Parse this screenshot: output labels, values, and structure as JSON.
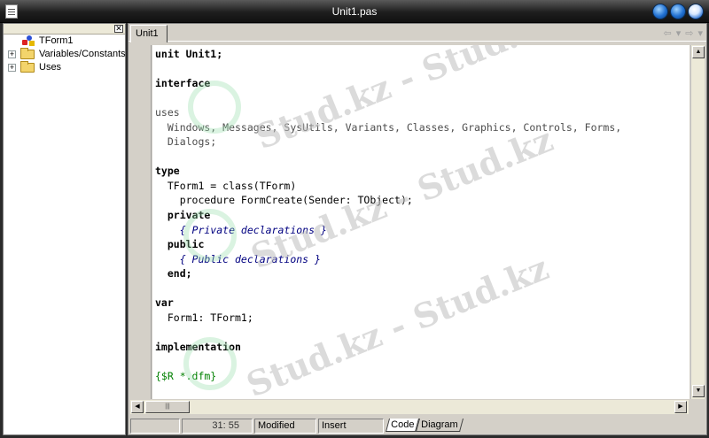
{
  "window": {
    "title": "Unit1.pas"
  },
  "tree": {
    "items": [
      {
        "label": "TForm1",
        "icon": "form-icon",
        "expandable": false
      },
      {
        "label": "Variables/Constants",
        "icon": "folder-icon",
        "expandable": true
      },
      {
        "label": "Uses",
        "icon": "folder-icon",
        "expandable": true
      }
    ],
    "close_glyph": "✕"
  },
  "editor": {
    "tab_label": "Unit1",
    "nav": {
      "back": "⇦",
      "back_drop": "▾",
      "forward": "⇨",
      "forward_drop": "▾"
    }
  },
  "code": {
    "lines": [
      "unit Unit1;",
      "",
      "interface",
      "",
      "uses",
      "  Windows, Messages, SysUtils, Variants, Classes, Graphics, Controls, Forms,",
      "  Dialogs;",
      "",
      "type",
      "  TForm1 = class(TForm)",
      "    procedure FormCreate(Sender: TObject);",
      "  private",
      "    { Private declarations }",
      "  public",
      "    { Public declarations }",
      "  end;",
      "",
      "var",
      "  Form1: TForm1;",
      "",
      "implementation",
      "",
      "{$R *.dfm}"
    ]
  },
  "status": {
    "position": "31: 55",
    "modified": "Modified",
    "mode": "Insert",
    "tabs": [
      "Code",
      "Diagram"
    ]
  },
  "scroll": {
    "up": "▲",
    "down": "▼",
    "left": "◀",
    "right": "▶",
    "thumb_grip": "|||"
  },
  "watermark": {
    "text": "Stud.kz - Stud.kz"
  },
  "colors": {
    "keyword": "#000000",
    "comment": "#000080",
    "directive": "#008000",
    "titlebar": "#1e1e1e"
  }
}
